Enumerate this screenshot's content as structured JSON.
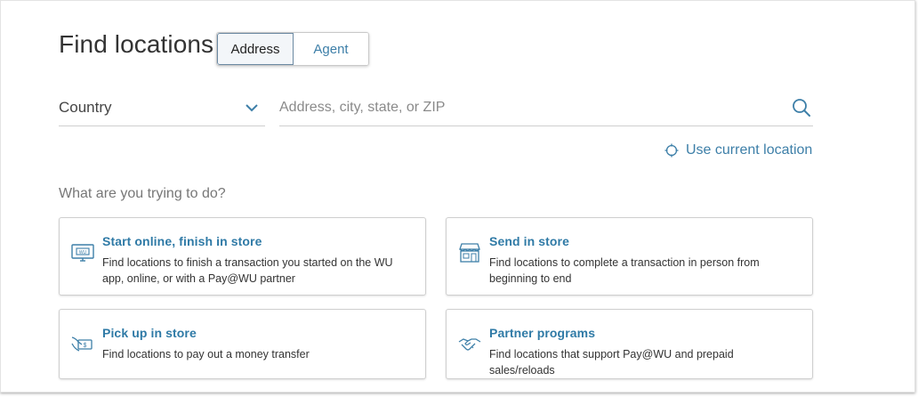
{
  "page": {
    "title": "Find locations",
    "tabs": [
      {
        "label": "Address",
        "active": true
      },
      {
        "label": "Agent",
        "active": false
      }
    ]
  },
  "search": {
    "country_label": "Country",
    "address_placeholder": "Address, city, state, or ZIP",
    "address_value": "",
    "use_location_label": "Use current location"
  },
  "options": {
    "heading": "What are you trying to do?",
    "cards": [
      {
        "title": "Start online, finish in store",
        "description": "Find locations to finish a transaction you started on the WU app, online, or with a Pay@WU partner",
        "icon": "monitor-icon"
      },
      {
        "title": "Send in store",
        "description": "Find locations to complete a transaction in person from beginning to end",
        "icon": "storefront-icon"
      },
      {
        "title": "Pick up in store",
        "description": "Find locations to pay out a money transfer",
        "icon": "hand-money-icon"
      },
      {
        "title": "Partner programs",
        "description": "Find locations that support Pay@WU and prepaid sales/reloads",
        "icon": "handshake-icon"
      }
    ]
  },
  "colors": {
    "accent": "#3d7fa8",
    "card_title": "#2f7aa6",
    "border": "#cfcfcf"
  }
}
